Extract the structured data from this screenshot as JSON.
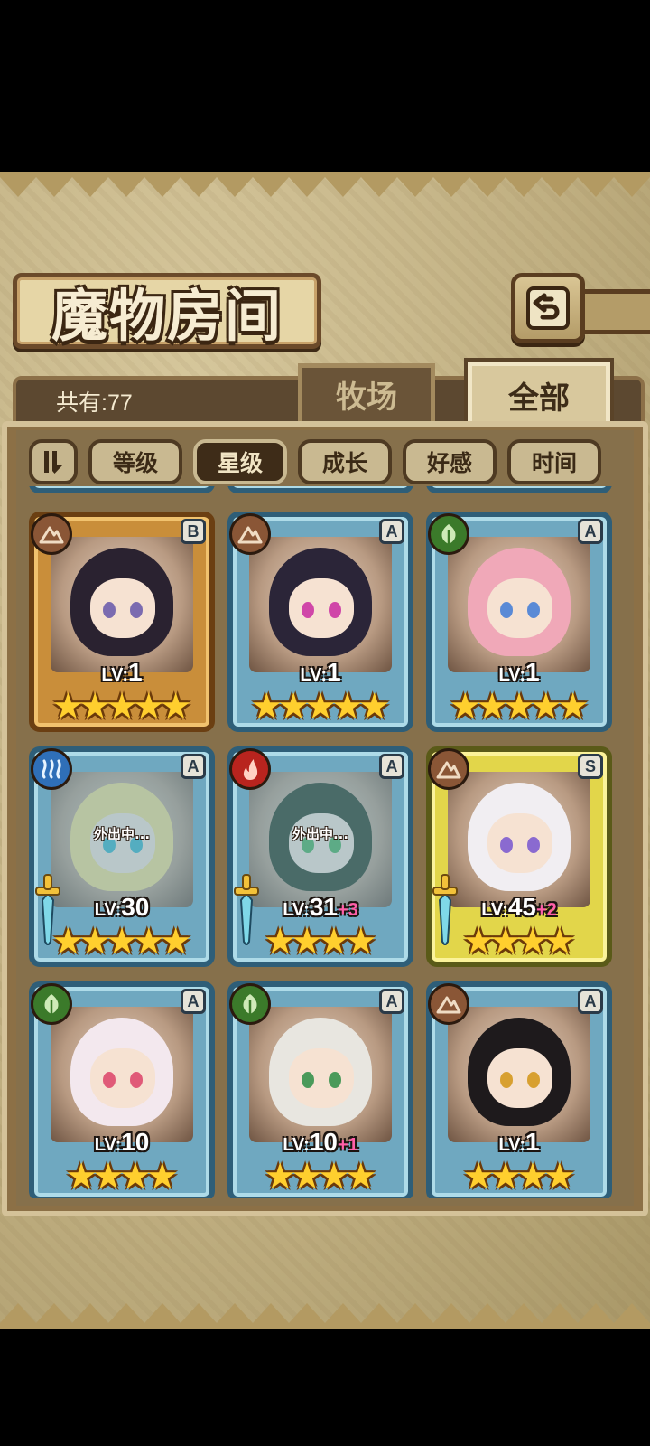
{
  "title": "魔物房间",
  "header": {
    "count_label": "共有:77"
  },
  "tabs": [
    {
      "label": "牧场",
      "active": false
    },
    {
      "label": "全部",
      "active": true
    }
  ],
  "sort": {
    "toggle_icon": "sort-order-icon",
    "buttons": [
      {
        "label": "等级",
        "active": false
      },
      {
        "label": "星级",
        "active": true
      },
      {
        "label": "成长",
        "active": false
      },
      {
        "label": "好感",
        "active": false
      },
      {
        "label": "时间",
        "active": false
      }
    ]
  },
  "away_label": "外出中...",
  "level_prefix": "LV:",
  "cards": [
    {
      "element": "earth",
      "rank": "B",
      "frame": "gold",
      "level": "1",
      "bonus": "",
      "stars": 5,
      "away": false,
      "weapon": false,
      "hair": "#2a2230",
      "eyes": "#7b6bb0"
    },
    {
      "element": "earth",
      "rank": "A",
      "frame": "blue",
      "level": "1",
      "bonus": "",
      "stars": 5,
      "away": false,
      "weapon": false,
      "hair": "#2b2538",
      "eyes": "#d046a8"
    },
    {
      "element": "grass",
      "rank": "A",
      "frame": "blue",
      "level": "1",
      "bonus": "",
      "stars": 5,
      "away": false,
      "weapon": false,
      "hair": "#f0a8b8",
      "eyes": "#5a8ad6"
    },
    {
      "element": "water",
      "rank": "A",
      "frame": "blue",
      "level": "30",
      "bonus": "",
      "stars": 5,
      "away": true,
      "weapon": true,
      "hair": "#f2dc8a",
      "eyes": "#3fb2c0"
    },
    {
      "element": "fire",
      "rank": "A",
      "frame": "blue",
      "level": "31",
      "bonus": "+3",
      "stars": 4,
      "away": true,
      "weapon": true,
      "hair": "#2c3a22",
      "eyes": "#4fae58"
    },
    {
      "element": "earth",
      "rank": "S",
      "frame": "yellow",
      "level": "45",
      "bonus": "+2",
      "stars": 4,
      "away": false,
      "weapon": true,
      "hair": "#f1eef2",
      "eyes": "#8a6ad0"
    },
    {
      "element": "grass",
      "rank": "A",
      "frame": "blue",
      "level": "10",
      "bonus": "",
      "stars": 4,
      "away": false,
      "weapon": false,
      "hair": "#f3e8ee",
      "eyes": "#e05a78"
    },
    {
      "element": "grass",
      "rank": "A",
      "frame": "blue",
      "level": "10",
      "bonus": "+1",
      "stars": 4,
      "away": false,
      "weapon": false,
      "hair": "#e8e6e0",
      "eyes": "#4a9a5a"
    },
    {
      "element": "earth",
      "rank": "A",
      "frame": "blue",
      "level": "1",
      "bonus": "",
      "stars": 4,
      "away": false,
      "weapon": false,
      "hair": "#1e1a1c",
      "eyes": "#d8a030"
    }
  ],
  "colors": {
    "frame_blue": "#2e5e78",
    "frame_gold": "#6b3f12",
    "frame_yellow": "#e2d64a",
    "star": "#ffcf2e",
    "level_bonus": "#ff5fa8"
  },
  "icons": {
    "back": "return-arrow-icon",
    "element_earth": "mountain-icon",
    "element_grass": "leaf-icon",
    "element_water": "water-icon",
    "element_fire": "flame-icon",
    "weapon": "sword-icon",
    "star": "star-icon"
  }
}
